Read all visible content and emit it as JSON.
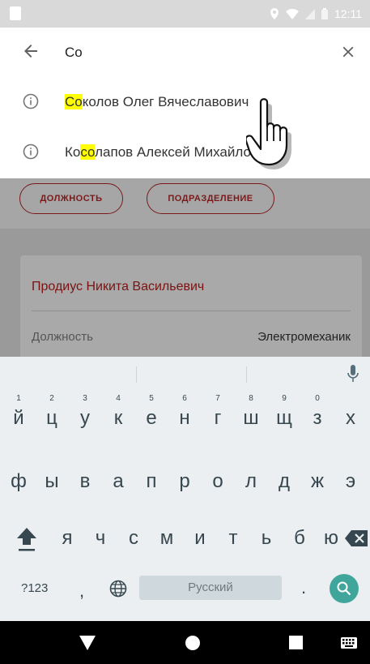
{
  "status_bar": {
    "time": "12:11"
  },
  "search": {
    "query": "Co"
  },
  "suggestions": [
    {
      "highlight": "Со",
      "rest": "колов Олег Вячеславович"
    },
    {
      "prefix": "Ко",
      "highlight": "со",
      "rest": "лапов Алексей Михайло"
    }
  ],
  "filters": {
    "position": "ДОЛЖНОСТЬ",
    "department": "ПОДРАЗДЕЛЕНИЕ"
  },
  "card": {
    "name": "Продиус Никита Васильевич",
    "label": "Должность",
    "value": "Электромеханик"
  },
  "keyboard": {
    "row1": [
      {
        "hint": "1",
        "ch": "й"
      },
      {
        "hint": "2",
        "ch": "ц"
      },
      {
        "hint": "3",
        "ch": "у"
      },
      {
        "hint": "4",
        "ch": "к"
      },
      {
        "hint": "5",
        "ch": "е"
      },
      {
        "hint": "6",
        "ch": "н"
      },
      {
        "hint": "7",
        "ch": "г"
      },
      {
        "hint": "8",
        "ch": "ш"
      },
      {
        "hint": "9",
        "ch": "щ"
      },
      {
        "hint": "0",
        "ch": "з"
      },
      {
        "hint": "",
        "ch": "х"
      }
    ],
    "row2": [
      "ф",
      "ы",
      "в",
      "а",
      "п",
      "р",
      "о",
      "л",
      "д",
      "ж",
      "э"
    ],
    "row3": [
      "я",
      "ч",
      "с",
      "м",
      "и",
      "т",
      "ь",
      "б",
      "ю"
    ],
    "symbols_label": "?123",
    "comma": ",",
    "space_label": "Русский",
    "period": "."
  }
}
